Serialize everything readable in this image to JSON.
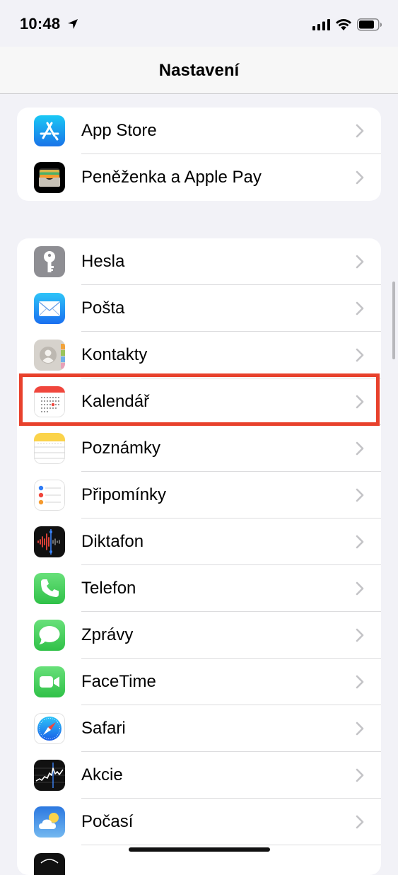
{
  "status": {
    "time": "10:48"
  },
  "nav": {
    "title": "Nastavení"
  },
  "group1": [
    {
      "label": "App Store",
      "icon": "app-store-icon"
    },
    {
      "label": "Peněženka a Apple Pay",
      "icon": "wallet-icon"
    }
  ],
  "group2": [
    {
      "label": "Hesla",
      "icon": "key-icon"
    },
    {
      "label": "Pošta",
      "icon": "mail-icon"
    },
    {
      "label": "Kontakty",
      "icon": "contacts-icon"
    },
    {
      "label": "Kalendář",
      "icon": "calendar-icon"
    },
    {
      "label": "Poznámky",
      "icon": "notes-icon"
    },
    {
      "label": "Připomínky",
      "icon": "reminders-icon"
    },
    {
      "label": "Diktafon",
      "icon": "voice-memos-icon"
    },
    {
      "label": "Telefon",
      "icon": "phone-icon"
    },
    {
      "label": "Zprávy",
      "icon": "messages-icon"
    },
    {
      "label": "FaceTime",
      "icon": "facetime-icon"
    },
    {
      "label": "Safari",
      "icon": "safari-icon"
    },
    {
      "label": "Akcie",
      "icon": "stocks-icon"
    },
    {
      "label": "Počasí",
      "icon": "weather-icon"
    },
    {
      "label": "",
      "icon": "translate-icon"
    }
  ],
  "highlight": {
    "item": "Kalendář",
    "color": "#e8412c"
  },
  "colors": {
    "background": "#f2f2f7",
    "chevron": "#c4c4c7",
    "separator": "#dcdcde"
  }
}
